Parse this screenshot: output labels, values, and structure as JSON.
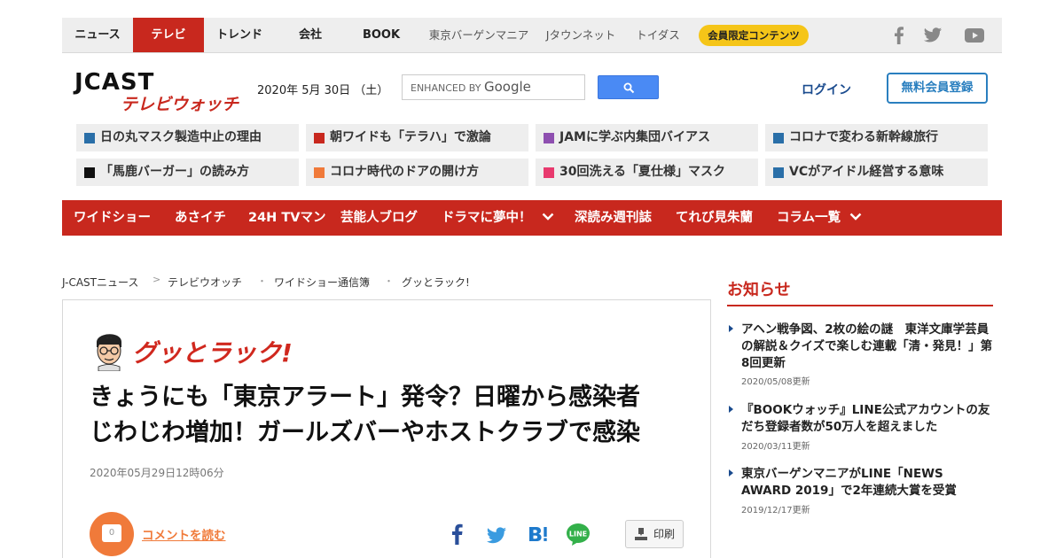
{
  "topnav": {
    "items": [
      "ニュース",
      "テレビ",
      "トレンド",
      "会社",
      "BOOK",
      "東京バーゲンマニア",
      "Jタウンネット",
      "トイダス"
    ],
    "member_pill": "会員限定コンテンツ",
    "active_color": "#c8281e"
  },
  "header": {
    "logo_main": "JCAST",
    "logo_sub": "テレビウォッチ",
    "date": "2020年 5月 30日 （土）",
    "search_label": "ENHANCED BY",
    "search_brand": "Google",
    "login": "ログイン",
    "register": "無料会員登録"
  },
  "topics": [
    {
      "label": "日の丸マスク製造中止の理由",
      "color": "#2a6fa8"
    },
    {
      "label": "朝ワイドも「テラハ」で激論",
      "color": "#c8281e"
    },
    {
      "label": "JAMに学ぶ内集団バイアス",
      "color": "#8e4fb0"
    },
    {
      "label": "コロナで変わる新幹線旅行",
      "color": "#2a6fa8"
    },
    {
      "label": "「馬鹿バーガー」の読み方",
      "color": "#111111"
    },
    {
      "label": "コロナ時代のドアの開け方",
      "color": "#f07a3a"
    },
    {
      "label": "30回洗える「夏仕様」マスク",
      "color": "#e83a6e"
    },
    {
      "label": "VCがアイドル経営する意味",
      "color": "#2a6fa8"
    }
  ],
  "rednav": {
    "items": [
      "ワイドショー",
      "あさイチ",
      "24H TVマン",
      "芸能人ブログ",
      "ドラマに夢中！",
      "深読み週刊誌",
      "てれび見朱蘭",
      "コラム一覧"
    ]
  },
  "breadcrumb": [
    "J-CASTニュース",
    "テレビウオッチ",
    "ワイドショー通信簿",
    "グッとラック!"
  ],
  "article": {
    "program": "グッとラック!",
    "headline_line1": "きょうにも「東京アラート」発令？日曜から感染者",
    "headline_line2": "じわじわ増加！ガールズバーやホストクラブで感染",
    "date": "2020年05月29日12時06分",
    "comment_count": "0",
    "comment_link": "コメントを読む",
    "print": "印刷"
  },
  "sidebar": {
    "title": "お知らせ",
    "news": [
      {
        "text": "アヘン戦争図、2枚の絵の謎　東洋文庫学芸員の解説＆クイズで楽しむ連載「清・発見！」第8回更新",
        "date": "2020/05/08更新"
      },
      {
        "text": "『BOOKウォッチ』LINE公式アカウントの友だち登録者数が50万人を超えました",
        "date": "2020/03/11更新"
      },
      {
        "text": "東京バーゲンマニアがLINE「NEWS AWARD 2019」で2年連続大賞を受賞",
        "date": "2019/12/17更新"
      }
    ]
  }
}
